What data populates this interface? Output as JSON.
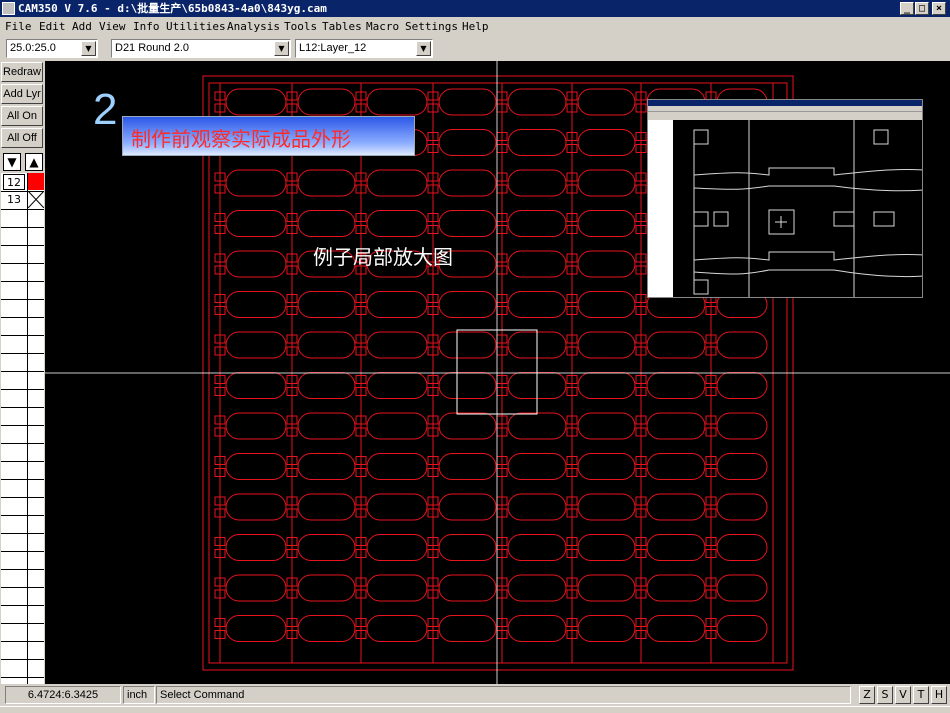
{
  "window": {
    "title": "CAM350 V 7.6 - d:\\批量生产\\65b0843-4a0\\843yg.cam",
    "minimize": "_",
    "maximize": "□",
    "close": "×"
  },
  "menu": [
    "File",
    "Edit",
    "Add",
    "View",
    "Info",
    "Utilities",
    "Analysis",
    "Tools",
    "Tables",
    "Macro",
    "Settings",
    "Help"
  ],
  "toolbar": {
    "grid_value": "25.0:25.0",
    "dcode_value": "D21   Round 2.0",
    "layer_value": "L12:Layer_12"
  },
  "left_panel": {
    "redraw": "Redraw",
    "add_layer": "Add Lyr",
    "all_on": "All On",
    "all_off": "All Off",
    "up_arrow": "▲",
    "down_arrow": "▼",
    "layers": [
      {
        "num": "12",
        "color": "#ff0000",
        "active": true
      },
      {
        "num": "13",
        "color": "none",
        "active": false
      }
    ]
  },
  "overlay": {
    "slide_number": "2",
    "caption": "制作前观察实际成品外形",
    "example_label": "例子局部放大图"
  },
  "status": {
    "coordinates": "6.4724:6.3425",
    "units": "inch",
    "command": "Select Command",
    "modes": [
      "Z",
      "S",
      "V",
      "T",
      "H"
    ]
  },
  "colors": {
    "outline": "#e8141e",
    "crosshair": "#ffffff",
    "caption_text": "#ff2a2a",
    "slide_number": "#9ed0ff"
  }
}
